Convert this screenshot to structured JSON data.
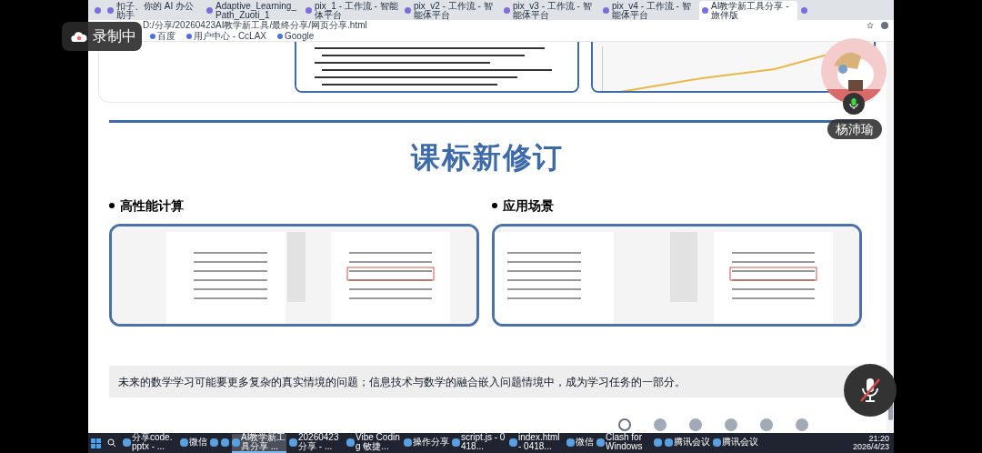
{
  "recording_badge": {
    "label": "录制中"
  },
  "browser": {
    "tabs": [
      {
        "selected": false
      },
      {
        "title": "扣子、你的 AI 办公助手",
        "selected": false
      },
      {
        "title": "Adaptive_Learning_Path_Zuoti_1",
        "selected": false
      },
      {
        "title": "pix_1 - 工作流 - 智能体平台",
        "selected": false
      },
      {
        "title": "pix_v2 - 工作流 - 智能体平台",
        "selected": false
      },
      {
        "title": "pix_v3 - 工作流 - 智能体平台",
        "selected": false
      },
      {
        "title": "pix_v4 - 工作流 - 智能体平台",
        "selected": false
      },
      {
        "title": "AI教学新工具分享 - 旅伴版",
        "selected": true
      },
      {
        "selected": false
      }
    ],
    "url": "D:/分享/20260423AI教学新工具/最终分享/网页分享.html",
    "bookmarks": [
      {
        "label": "百度"
      },
      {
        "label": "用户中心 - CcLAX"
      },
      {
        "label": "Google"
      }
    ]
  },
  "page": {
    "title": "课标新修订",
    "sections": [
      {
        "heading": "高性能计算"
      },
      {
        "heading": "应用场景"
      }
    ],
    "caption": "未来的数学学习可能要更多复杂的真实情境的问题；信息技术与数学的融合嵌入问题情境中，成为学习任务的一部分。",
    "slides": [
      {
        "selected": true
      },
      {
        "selected": false
      },
      {
        "selected": false
      },
      {
        "selected": false
      },
      {
        "selected": false
      },
      {
        "selected": false
      }
    ]
  },
  "participant": {
    "name": "杨沛瑜",
    "mic_on": true
  },
  "mute_button": {
    "muted": true
  },
  "taskbar": {
    "items": [
      {
        "label": "分享code.pptx - ...",
        "selected": false
      },
      {
        "label": "微信",
        "selected": false
      },
      {
        "selected": false
      },
      {
        "selected": false
      },
      {
        "label": "AI教学新工具分享 ...",
        "selected": true
      },
      {
        "label": "20260423分享 - ...",
        "selected": false
      },
      {
        "label": "Vibe Coding 敏捷...",
        "selected": false
      },
      {
        "label": "操作分享",
        "selected": false
      },
      {
        "label": "script.js - 0418...",
        "selected": false
      },
      {
        "label": "index.html - 0418...",
        "selected": false
      },
      {
        "label": "微信",
        "selected": false
      },
      {
        "label": "Clash for Windows",
        "selected": false
      },
      {
        "selected": false
      },
      {
        "label": "腾讯会议",
        "selected": false
      },
      {
        "label": "腾讯会议",
        "selected": false
      }
    ],
    "time": "21:20",
    "date": "2026/4/23"
  }
}
